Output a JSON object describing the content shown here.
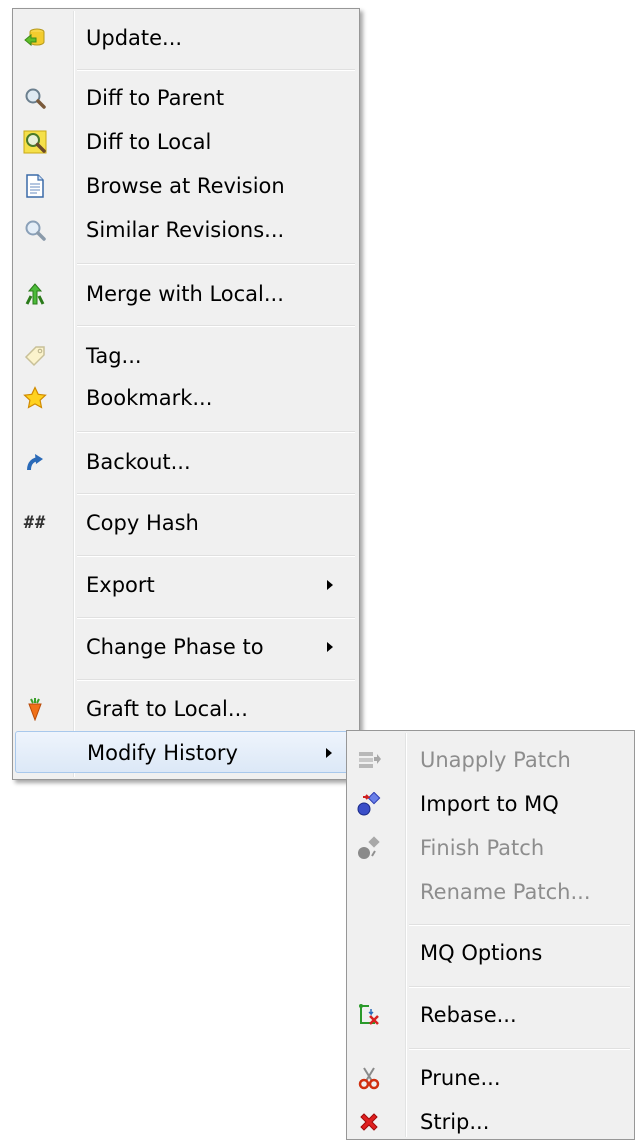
{
  "main_menu": {
    "items": [
      {
        "label": "Update...",
        "icon": "update-icon"
      },
      {
        "label": "Diff to Parent",
        "icon": "diff-parent-icon"
      },
      {
        "label": "Diff to Local",
        "icon": "diff-local-icon"
      },
      {
        "label": "Browse at Revision",
        "icon": "document-icon"
      },
      {
        "label": "Similar Revisions...",
        "icon": "magnifier-icon"
      },
      {
        "label": "Merge with Local...",
        "icon": "merge-icon"
      },
      {
        "label": "Tag...",
        "icon": "tag-icon"
      },
      {
        "label": "Bookmark...",
        "icon": "star-icon"
      },
      {
        "label": "Backout...",
        "icon": "backout-icon"
      },
      {
        "label": "Copy Hash",
        "icon": "hash-icon",
        "glyph": "##"
      },
      {
        "label": "Export",
        "icon": "",
        "submenu": true
      },
      {
        "label": "Change Phase to",
        "icon": "",
        "submenu": true
      },
      {
        "label": "Graft to Local...",
        "icon": "graft-icon"
      },
      {
        "label": "Modify History",
        "icon": "",
        "submenu": true,
        "highlighted": true
      }
    ]
  },
  "submenu": {
    "items": [
      {
        "label": "Unapply Patch",
        "icon": "unapply-patch-icon",
        "disabled": true
      },
      {
        "label": "Import to MQ",
        "icon": "import-mq-icon"
      },
      {
        "label": "Finish Patch",
        "icon": "finish-patch-icon",
        "disabled": true
      },
      {
        "label": "Rename Patch...",
        "icon": "",
        "disabled": true
      },
      {
        "label": "MQ Options",
        "icon": ""
      },
      {
        "label": "Rebase...",
        "icon": "rebase-icon"
      },
      {
        "label": "Prune...",
        "icon": "scissors-icon"
      },
      {
        "label": "Strip...",
        "icon": "red-x-icon"
      }
    ]
  },
  "colors": {
    "menu_bg": "#f0f0f0",
    "border": "#979797",
    "highlight_border": "#a8c8ec",
    "disabled_text": "#8d8d8d"
  }
}
